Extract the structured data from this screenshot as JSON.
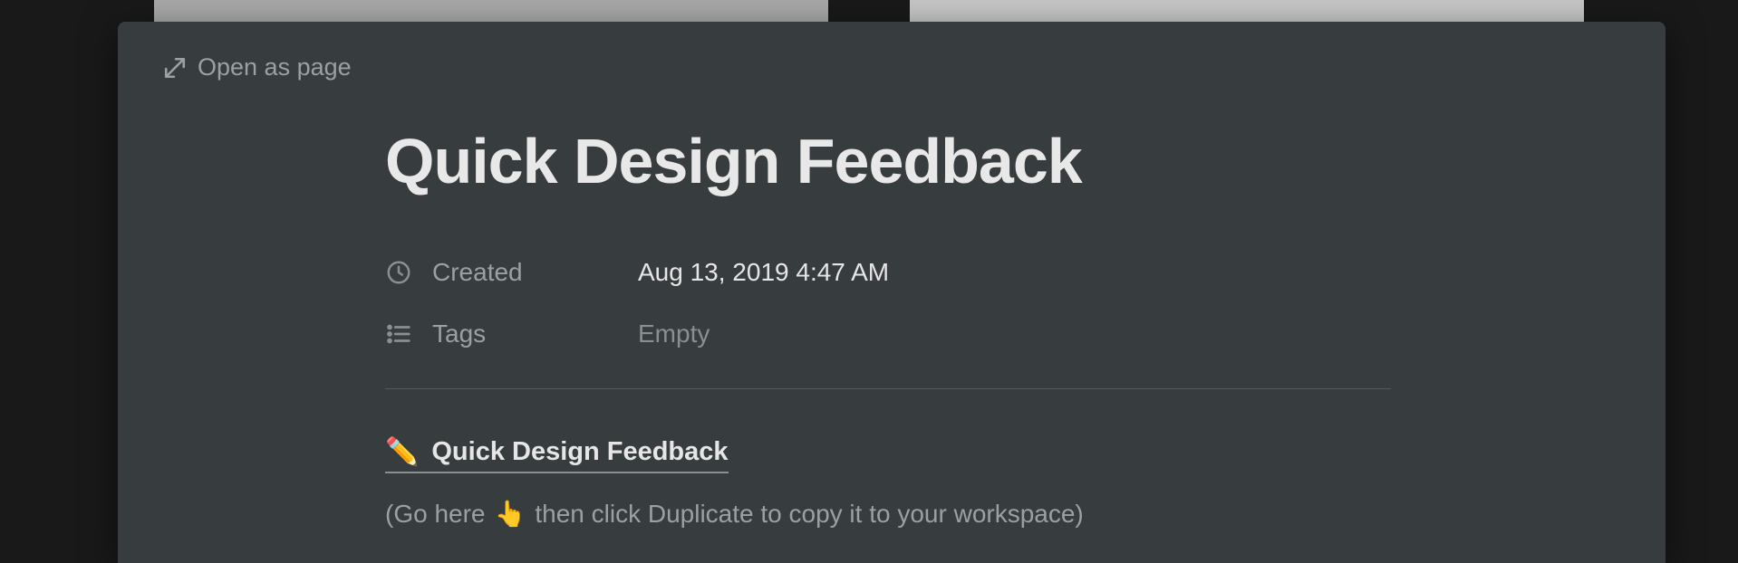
{
  "open_as_page_label": "Open as page",
  "page_title": "Quick Design Feedback",
  "properties": {
    "created": {
      "label": "Created",
      "value": "Aug 13, 2019 4:47 AM"
    },
    "tags": {
      "label": "Tags",
      "value": "Empty"
    }
  },
  "body": {
    "link_text": "Quick Design Feedback",
    "pencil_emoji": "✏️",
    "hint_prefix": "(Go here ",
    "pointing_emoji": "👆",
    "hint_suffix": " then click Duplicate to copy it to your workspace)"
  }
}
